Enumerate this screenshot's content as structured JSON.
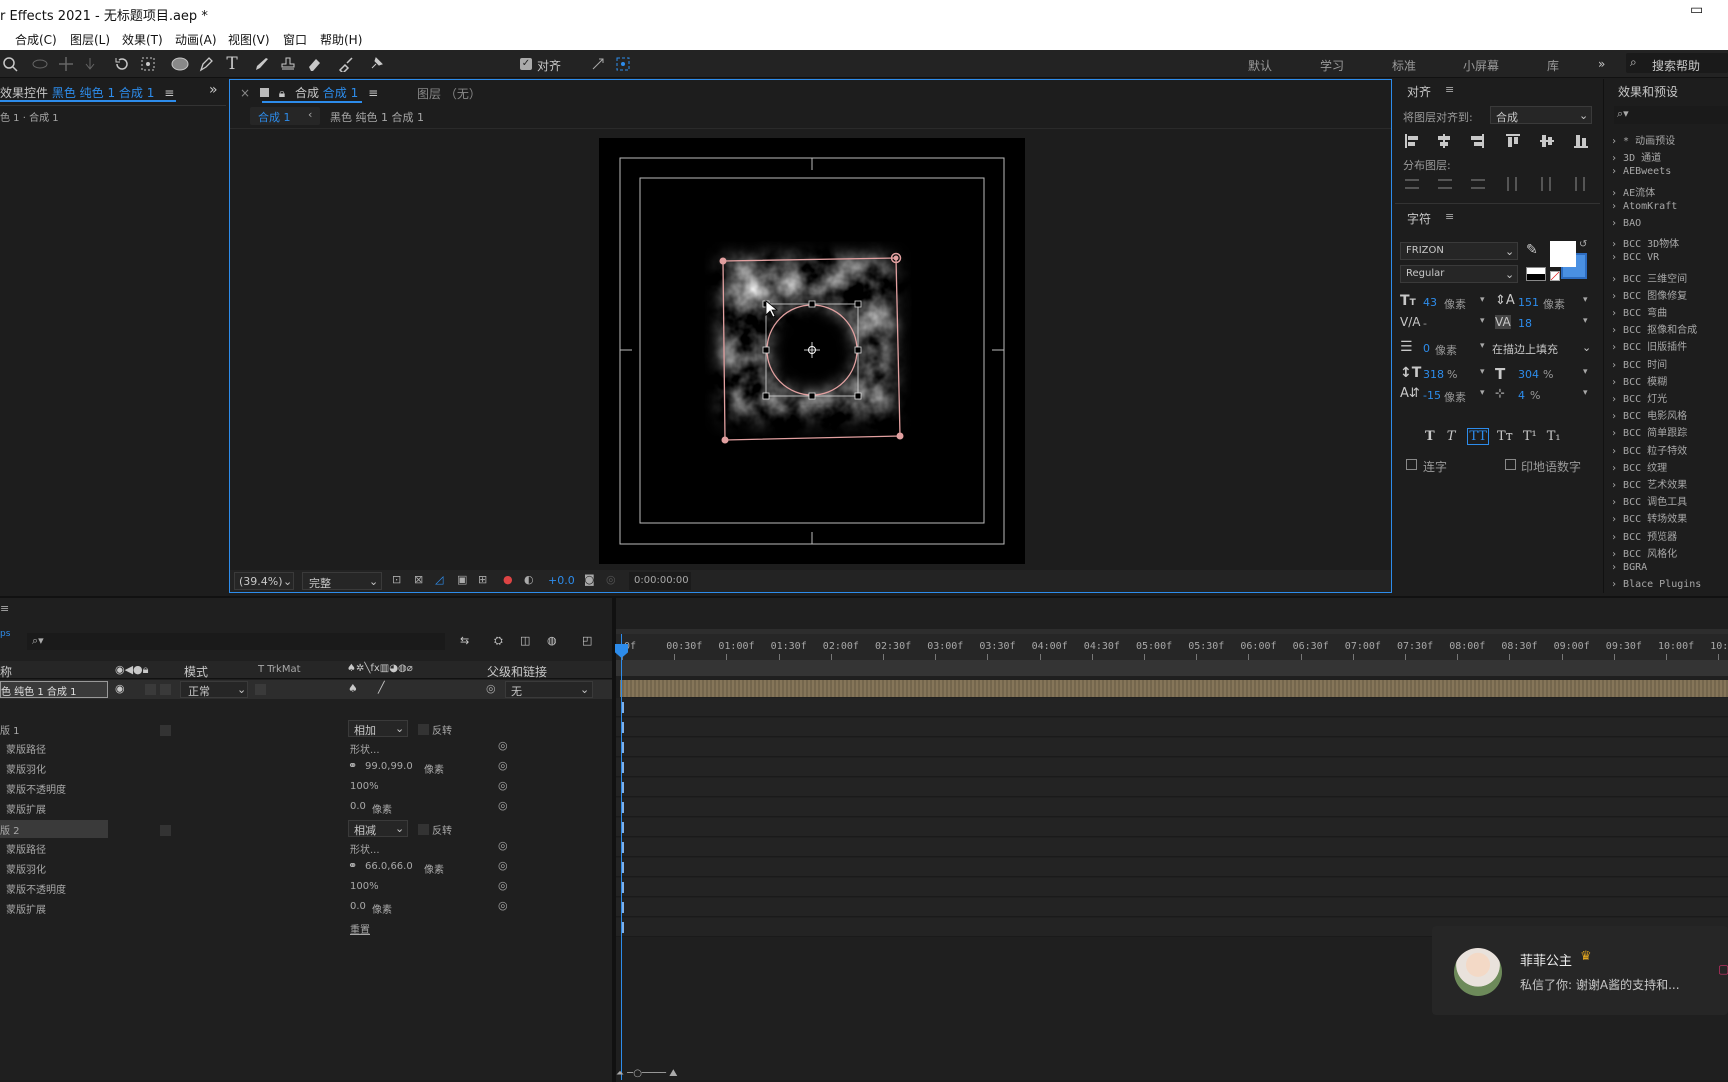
{
  "title": {
    "app": "r Effects 2021 - 无标题项目.aep *"
  },
  "menu": [
    "合成(C)",
    "图层(L)",
    "效果(T)",
    "动画(A)",
    "视图(V)",
    "窗口",
    "帮助(H)"
  ],
  "toolbar": {
    "align_label": "对齐",
    "workspaces": [
      "默认",
      "学习",
      "标准",
      "小屏幕",
      "库"
    ],
    "search_help": "搜索帮助"
  },
  "effects_panel": {
    "title": "效果控件",
    "layer": "黑色 纯色 1 合成 1",
    "sub": "色 1 · 合成 1"
  },
  "comp_panel": {
    "title": "合成",
    "comp_name": "合成 1",
    "layer_panel": "图层 （无）",
    "tab": "合成 1",
    "breadcrumb": "黑色 纯色 1 合成 1",
    "zoom": "(39.4%)",
    "quality": "完整",
    "exposure": "+0.0",
    "timecode": "0:00:00:00"
  },
  "align_panel": {
    "title": "对齐",
    "align_to_label": "将图层对齐到:",
    "align_to": "合成",
    "distribute": "分布图层:"
  },
  "char_panel": {
    "title": "字符",
    "font": "FRIZON",
    "style": "Regular",
    "size": "43",
    "size_unit": "像素",
    "leading": "151",
    "leading_unit": "像素",
    "kerning": "-",
    "tracking": "18",
    "stroke": "0",
    "stroke_unit": "像素",
    "stroke_mode": "在描边上填充",
    "vscale": "318",
    "hscale": "304",
    "baseline": "-15",
    "baseline_unit": "像素",
    "tsume": "4",
    "pct": "%",
    "ligature": "连字",
    "hindi": "印地语数字"
  },
  "fx_panel": {
    "title": "效果和预设",
    "items": [
      "* 动画预设",
      "3D 通道",
      "AEBweets",
      "AE流体",
      "AtomKraft",
      "BAO",
      "BCC 3D物体",
      "BCC VR",
      "BCC 三维空间",
      "BCC 图像修复",
      "BCC 弯曲",
      "BCC 抠像和合成",
      "BCC 旧版插件",
      "BCC 时间",
      "BCC 模糊",
      "BCC 灯光",
      "BCC 电影风格",
      "BCC 简单跟踪",
      "BCC 粒子特效",
      "BCC 纹理",
      "BCC 艺术效果",
      "BCC 调色工具",
      "BCC 转场效果",
      "BCC 预览器",
      "BCC 风格化",
      "BGRA",
      "Blace Plugins"
    ]
  },
  "timeline": {
    "col_name": "称",
    "col_mode": "模式",
    "col_trkmat": "T  TrkMat",
    "col_parent": "父级和链接",
    "layer_name": "色 纯色 1 合成 1",
    "layer_mode": "正常",
    "layer_parent": "无",
    "ticks": [
      "0f",
      "00:30f",
      "01:00f",
      "01:30f",
      "02:00f",
      "02:30f",
      "03:00f",
      "03:30f",
      "04:00f",
      "04:30f",
      "05:00f",
      "05:30f",
      "06:00f",
      "06:30f",
      "07:00f",
      "07:30f",
      "08:00f",
      "08:30f",
      "09:00f",
      "09:30f",
      "10:00f",
      "10:30"
    ],
    "mask1": {
      "name": "版 1",
      "mode": "相加",
      "invert": "反转",
      "props": [
        {
          "label": "蒙版路径",
          "value": "形状..."
        },
        {
          "label": "蒙版羽化",
          "value": "99.0,99.0",
          "unit": "像素"
        },
        {
          "label": "蒙版不透明度",
          "value": "100%"
        },
        {
          "label": "蒙版扩展",
          "value": "0.0",
          "unit": "像素"
        }
      ]
    },
    "mask2": {
      "name": "版 2",
      "mode": "相减",
      "invert": "反转",
      "props": [
        {
          "label": "蒙版路径",
          "value": "形状..."
        },
        {
          "label": "蒙版羽化",
          "value": "66.0,66.0",
          "unit": "像素"
        },
        {
          "label": "蒙版不透明度",
          "value": "100%"
        },
        {
          "label": "蒙版扩展",
          "value": "0.0",
          "unit": "像素"
        }
      ]
    },
    "reset": "重置"
  },
  "notification": {
    "name": "菲菲公主",
    "message": "私信了你: 谢谢A酱的支持和..."
  },
  "colors": {
    "accent": "#2d8ceb",
    "layer_bar": "#8a7a5e",
    "mask": "#e2a0a0"
  }
}
